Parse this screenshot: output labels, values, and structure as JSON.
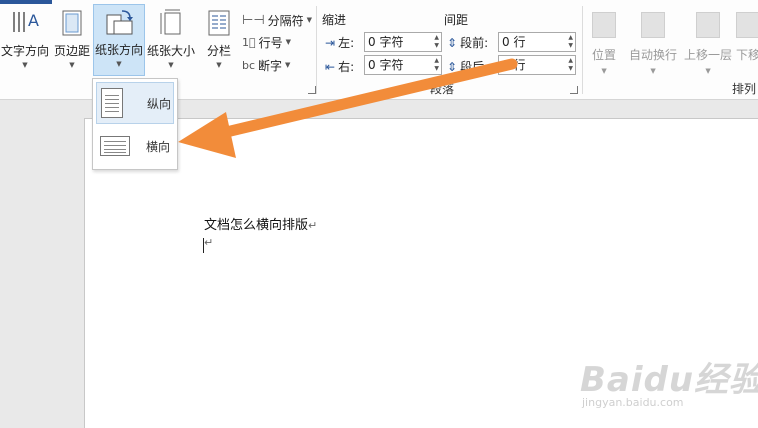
{
  "ribbon": {
    "buttons": {
      "text_direction": "文字方向",
      "margins": "页边距",
      "orientation": "纸张方向",
      "size": "纸张大小",
      "columns": "分栏"
    },
    "small": {
      "breaks": "分隔符",
      "line_numbers": "行号",
      "hyphenation": "断字"
    },
    "indent": {
      "header": "缩进",
      "left_label": "左:",
      "left_value": "0 字符",
      "right_label": "右:",
      "right_value": "0 字符"
    },
    "spacing": {
      "header": "间距",
      "before_label": "段前:",
      "before_value": "0 行",
      "after_label": "段后:",
      "after_value": "0 行"
    },
    "paragraph_group": "段落",
    "arrange": {
      "position": "位置",
      "wrap_text": "自动换行",
      "bring_forward": "上移一层",
      "send_backward": "下移",
      "group_label": "排列"
    }
  },
  "dropdown": {
    "portrait": "纵向",
    "landscape": "横向"
  },
  "document": {
    "line1": "文档怎么横向排版",
    "para_mark": "↵"
  },
  "watermark": {
    "logo": "Baidu经验",
    "url": "jingyan.baidu.com"
  },
  "colors": {
    "accent": "#2b579a",
    "arrow": "#f28c3a",
    "active_bg": "#cde4f7"
  }
}
